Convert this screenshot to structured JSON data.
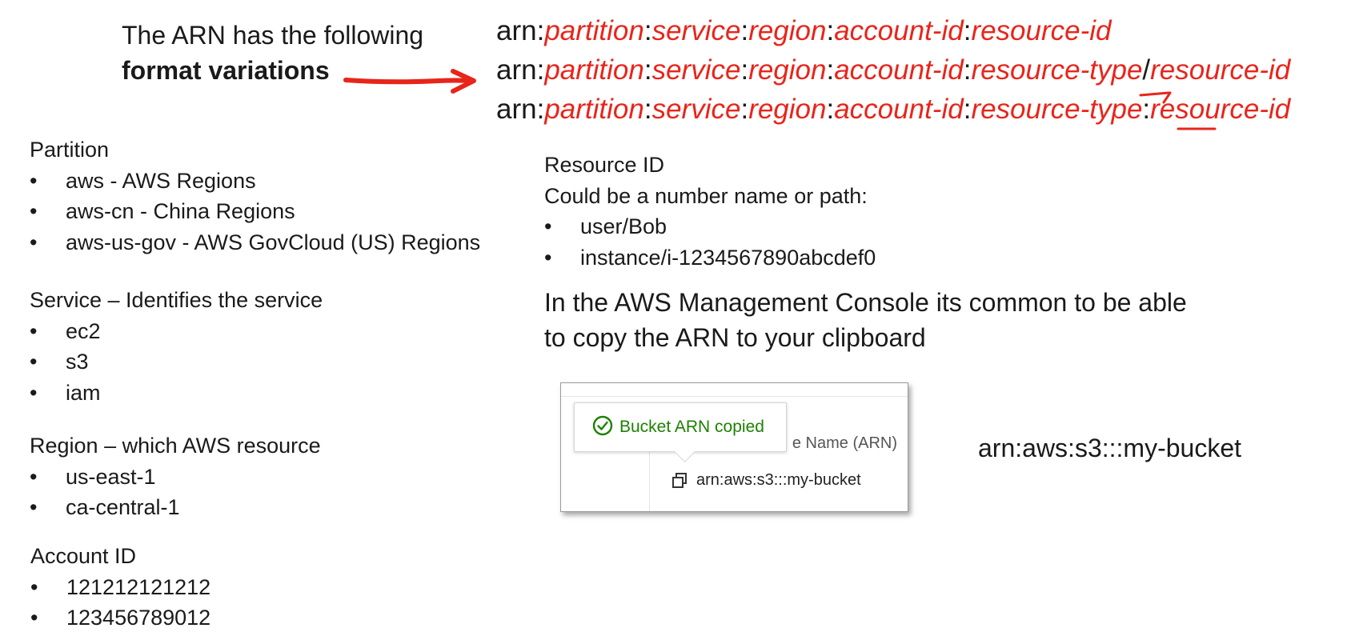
{
  "intro": {
    "line1": "The ARN has the following",
    "line2": "format variations"
  },
  "formats": [
    {
      "prefix": "arn:",
      "partition": "partition",
      "service": "service",
      "region": "region",
      "account": "account-id",
      "rtype": "",
      "sep": "",
      "rid": "resource-id"
    },
    {
      "prefix": "arn:",
      "partition": "partition",
      "service": "service",
      "region": "region",
      "account": "account-id",
      "rtype": "resource-type",
      "sep": "/",
      "rid": "resource-id"
    },
    {
      "prefix": "arn:",
      "partition": "partition",
      "service": "service",
      "region": "region",
      "account": "account-id",
      "rtype": "resource-type",
      "sep": ":",
      "rid": "resource-id"
    }
  ],
  "partition": {
    "title": "Partition",
    "items": [
      "aws - AWS Regions",
      "aws-cn - China Regions",
      "aws-us-gov - AWS GovCloud (US) Regions"
    ]
  },
  "service": {
    "title": "Service – Identifies the service",
    "items": [
      "ec2",
      "s3",
      "iam"
    ]
  },
  "region": {
    "title": "Region – which AWS resource",
    "items": [
      "us-east-1",
      "ca-central-1"
    ]
  },
  "account": {
    "title": "Account ID",
    "items": [
      "121212121212",
      "123456789012"
    ]
  },
  "resource": {
    "title": "Resource ID",
    "subtitle": "Could be a number name or path:",
    "items": [
      "user/Bob",
      "instance/i-1234567890abcdef0"
    ]
  },
  "console_note": {
    "line1": "In the AWS Management Console its common to be able",
    "line2": "to copy the ARN to your clipboard"
  },
  "console": {
    "toast": "Bucket ARN copied",
    "column_header": "e Name (ARN)",
    "arn_value": "arn:aws:s3:::my-bucket"
  },
  "example_arn": "arn:aws:s3:::my-bucket",
  "bullet": "•",
  "colors": {
    "accent": "#e8251b",
    "success": "#1d8102",
    "text": "#1a1a1a"
  },
  "icons": {
    "arrow": "arrow-right-icon",
    "check": "check-circle-icon",
    "copy": "copy-icon"
  }
}
